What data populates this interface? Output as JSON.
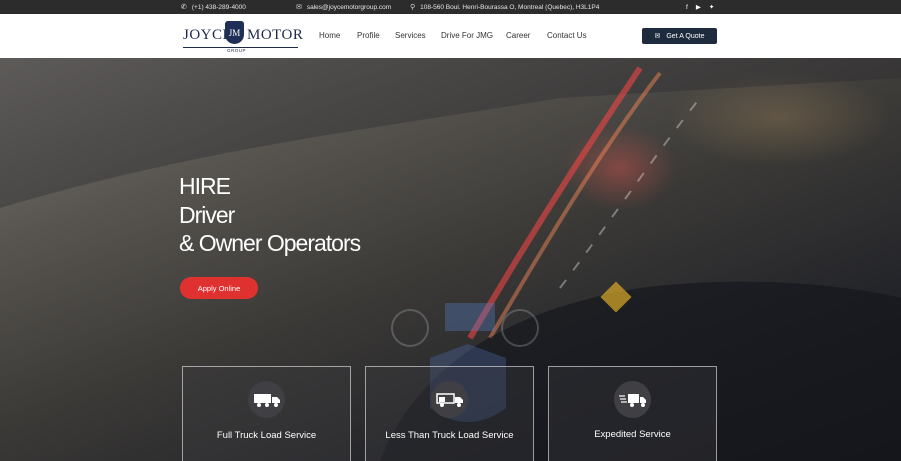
{
  "topbar": {
    "phone": "(+1) 438-289-4000",
    "email": "sales@joycemotorgroup.com",
    "address": "108-560 Boul. Henri-Bourassa O, Montreal (Quebec), H3L1P4",
    "phone_icon": "phone-icon",
    "email_icon": "envelope-icon",
    "address_icon": "map-pin-icon",
    "social": [
      {
        "icon": "facebook-icon",
        "glyph": "f"
      },
      {
        "icon": "youtube-icon",
        "glyph": "▶"
      },
      {
        "icon": "twitter-icon",
        "glyph": "✦"
      }
    ]
  },
  "logo": {
    "left": "JOYCE",
    "monogram": "JM",
    "right": "MOTOR",
    "sub": "GROUP"
  },
  "nav": [
    {
      "label": "Home"
    },
    {
      "label": "Profile"
    },
    {
      "label": "Services"
    },
    {
      "label": "Drive For JMG"
    },
    {
      "label": "Career"
    },
    {
      "label": "Contact Us"
    }
  ],
  "quote_button": {
    "label": "Get A Quote",
    "icon": "envelope-icon"
  },
  "hero": {
    "line1": "HIRE",
    "line2": "Driver",
    "line3": "& Owner Operators",
    "apply_label": "Apply Online"
  },
  "services": [
    {
      "label": "Full Truck Load Service",
      "icon": "truck-full-icon"
    },
    {
      "label": "Less Than Truck Load Service",
      "icon": "truck-partial-icon"
    },
    {
      "label": "Expedited Service",
      "icon": "truck-fast-icon"
    }
  ],
  "colors": {
    "topbar_bg": "#2c2c2c",
    "brand_navy": "#1f2e57",
    "quote_btn": "#1d2b3d",
    "apply_btn": "#e03131"
  }
}
